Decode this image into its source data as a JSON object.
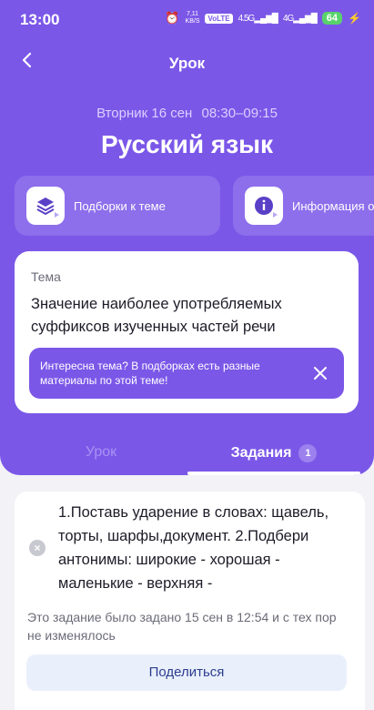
{
  "status_bar": {
    "time": "13:00",
    "speed": "7,11",
    "speed_unit": "KB/S",
    "volte": "VoLTE",
    "net1": "4.5G",
    "net2": "4G",
    "battery": "64"
  },
  "header": {
    "title": "Урок"
  },
  "lesson": {
    "day": "Вторник 16 сен",
    "time": "08:30–09:15",
    "subject": "Русский язык"
  },
  "chips": [
    {
      "label": "Подборки к теме",
      "icon": "layers-icon"
    },
    {
      "label": "Информация о",
      "icon": "info-icon"
    }
  ],
  "topic": {
    "label": "Тема",
    "text": "Значение наиболее употребляемых суффиксов изученных частей речи",
    "hint": "Интересна тема? В подборках есть разные материалы по этой теме!"
  },
  "tabs": {
    "lesson": "Урок",
    "tasks": "Задания",
    "tasks_count": "1"
  },
  "task": {
    "text": "1.Поставь ударение в словах: щавель, торты, шарфы,документ. 2.Подбери антонимы: широкие - хорошая - маленькие - верхняя -",
    "note": "Это задание было задано 15 сен в 12:54 и с тех пор не изменялось",
    "share": "Поделиться"
  },
  "colors": {
    "accent": "#7b57e8",
    "background": "#f2f2f7",
    "share_bg": "#eaf0fb"
  }
}
